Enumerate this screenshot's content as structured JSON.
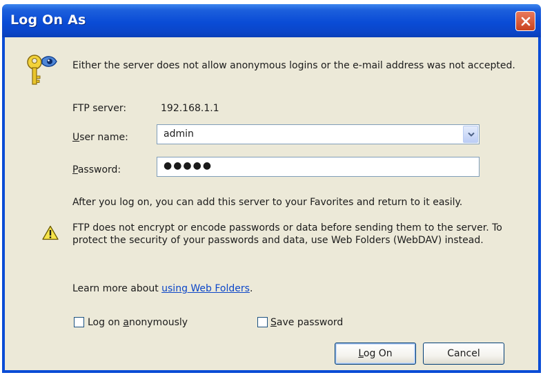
{
  "window": {
    "title": "Log On As"
  },
  "message": {
    "intro": "Either the server does not allow anonymous logins or the e-mail address was not accepted.",
    "after_logon": "After you log on, you can add this server to your Favorites and return to it easily.",
    "warning": "FTP does not encrypt or encode passwords or data before sending them to the server.  To protect the security of your passwords and data, use Web Folders (WebDAV) instead.",
    "learn_more_prefix": "Learn more about ",
    "learn_more_link": "using Web Folders",
    "learn_more_suffix": "."
  },
  "form": {
    "ftp_server_label": "FTP server:",
    "ftp_server_value": "192.168.1.1",
    "username_label_accel": "U",
    "username_label_rest": "ser name:",
    "username_value": "admin",
    "password_label_accel": "P",
    "password_label_rest": "assword:",
    "password_value": "●●●●●"
  },
  "options": {
    "anon_prefix": "Log on ",
    "anon_accel": "a",
    "anon_rest": "nonymously",
    "anon_checked": false,
    "save_accel": "S",
    "save_rest": "ave password",
    "save_checked": false
  },
  "buttons": {
    "logon_accel": "L",
    "logon_rest": "og On",
    "cancel": "Cancel"
  },
  "colors": {
    "titlebar": "#0a4cd6",
    "dialog_bg": "#ece9d8",
    "link": "#0b46c8"
  }
}
